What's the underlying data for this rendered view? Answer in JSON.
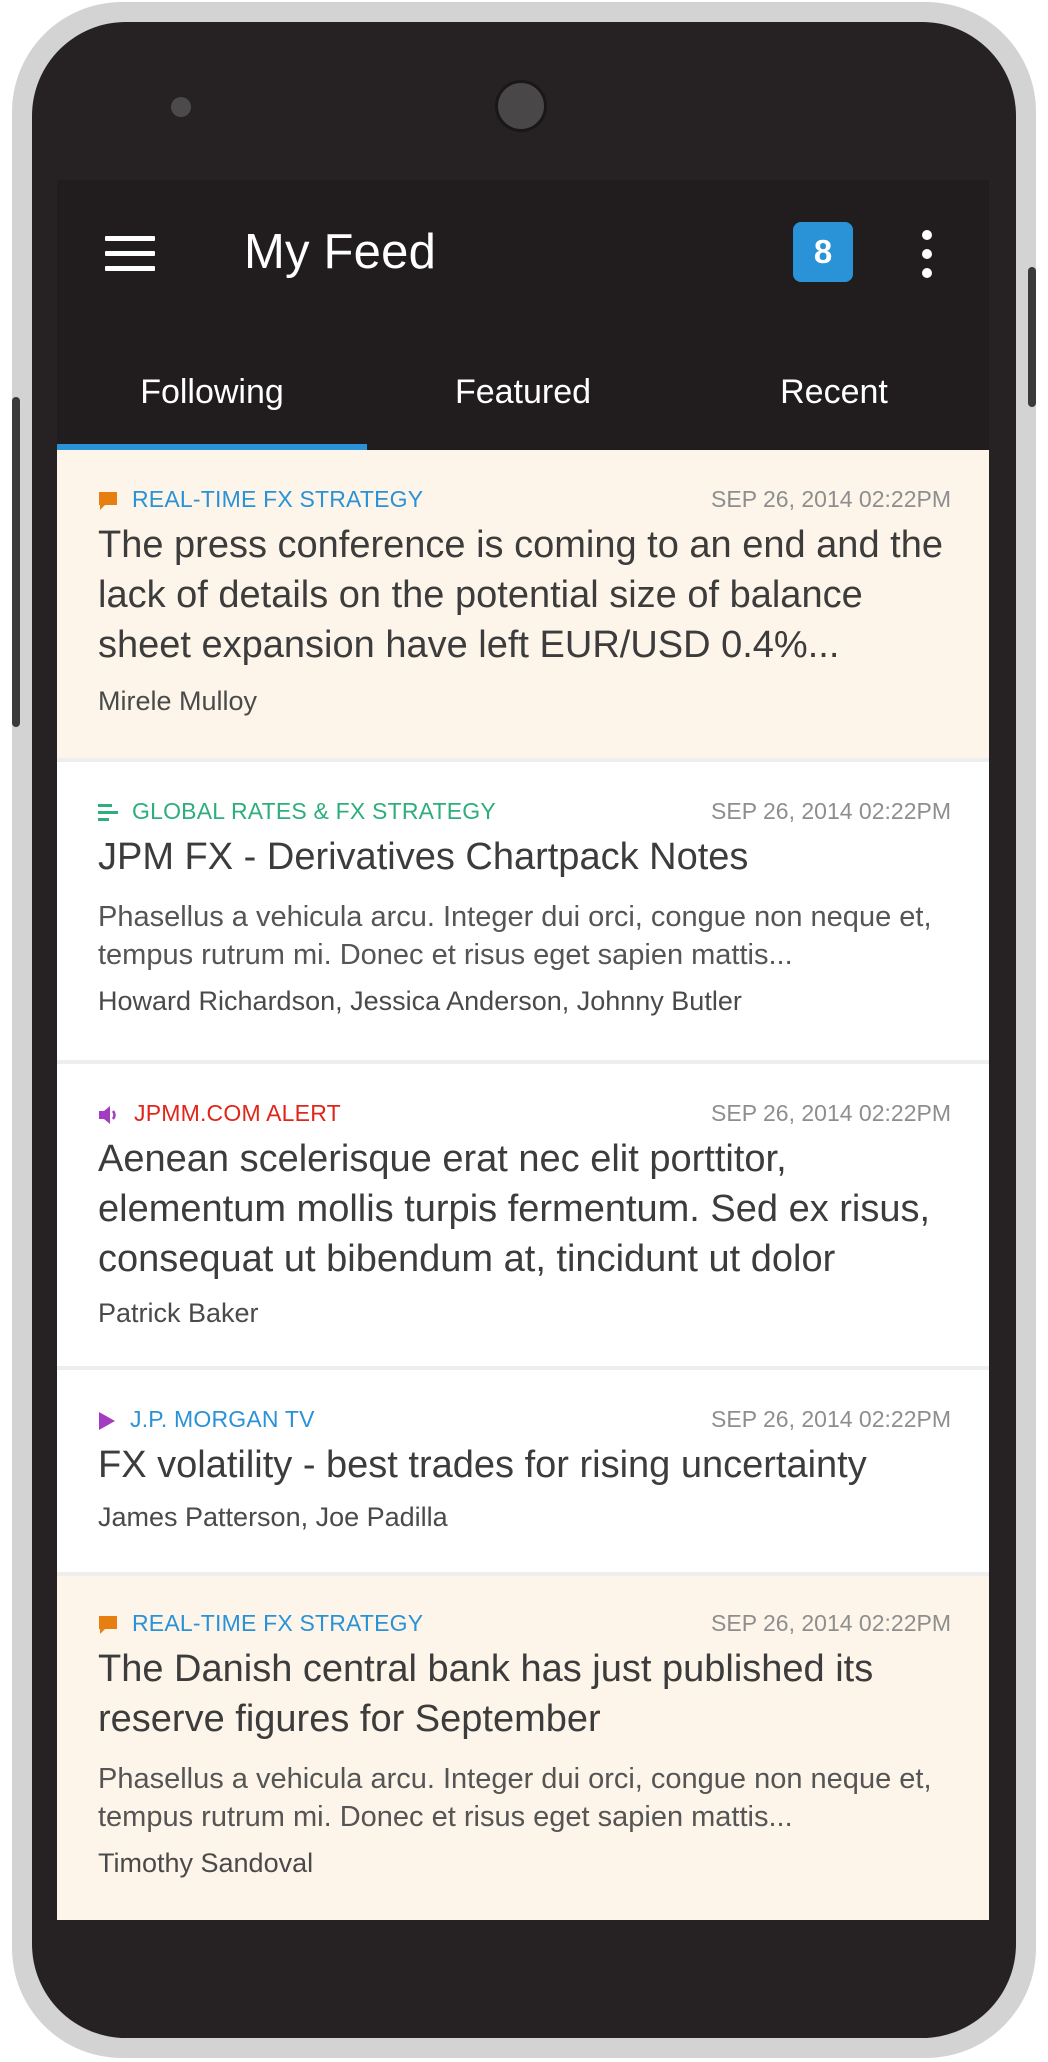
{
  "app": {
    "title": "My Feed",
    "notification_count": "8",
    "menu_icon": "hamburger-menu-icon",
    "more_icon": "more-vertical-icon"
  },
  "tabs": [
    {
      "label": "Following",
      "active": true
    },
    {
      "label": "Featured",
      "active": false
    },
    {
      "label": "Recent",
      "active": false
    }
  ],
  "colors": {
    "accent": "#2a92d6",
    "appbar": "#211d1e",
    "highlight_card": "#fdf5ea",
    "orange": "#e67e10",
    "green": "#2eae7c",
    "red": "#e0261b",
    "purple": "#a43cc2",
    "blue_link": "#2a92d6"
  },
  "feed": [
    {
      "category": "REAL-TIME FX STRATEGY",
      "category_icon": "chat-bubble-icon",
      "date": "SEP 26, 2014 02:22PM",
      "headline": "The press conference is coming to an end and the lack of details on the potential size of balance sheet expansion have left EUR/USD 0.4%...",
      "snippet": "",
      "authors": "Mirele Mulloy"
    },
    {
      "category": "GLOBAL RATES & FX STRATEGY",
      "category_icon": "document-lines-icon",
      "date": "SEP 26, 2014 02:22PM",
      "headline": "JPM FX - Derivatives Chartpack Notes",
      "snippet": "Phasellus a vehicula arcu. Integer dui orci, congue non neque et, tempus rutrum mi. Donec et risus eget sapien mattis...",
      "authors": "Howard Richardson, Jessica Anderson, Johnny Butler"
    },
    {
      "category": "JPMM.COM ALERT",
      "category_icon": "speaker-icon",
      "date": "SEP 26, 2014 02:22PM",
      "headline": "Aenean scelerisque erat nec elit porttitor, elementum mollis turpis fermentum. Sed ex risus, consequat ut bibendum at, tincidunt ut dolor",
      "snippet": "",
      "authors": "Patrick Baker"
    },
    {
      "category": "J.P. MORGAN TV",
      "category_icon": "play-icon",
      "date": "SEP 26, 2014 02:22PM",
      "headline": "FX volatility - best trades for rising uncertainty",
      "snippet": "",
      "authors": "James Patterson, Joe Padilla"
    },
    {
      "category": "REAL-TIME FX STRATEGY",
      "category_icon": "chat-bubble-icon",
      "date": "SEP 26, 2014 02:22PM",
      "headline": "The Danish central bank has just published its reserve figures for September",
      "snippet": "Phasellus a vehicula arcu. Integer dui orci, congue non neque et, tempus rutrum mi. Donec et risus eget sapien mattis...",
      "authors": "Timothy Sandoval"
    }
  ]
}
